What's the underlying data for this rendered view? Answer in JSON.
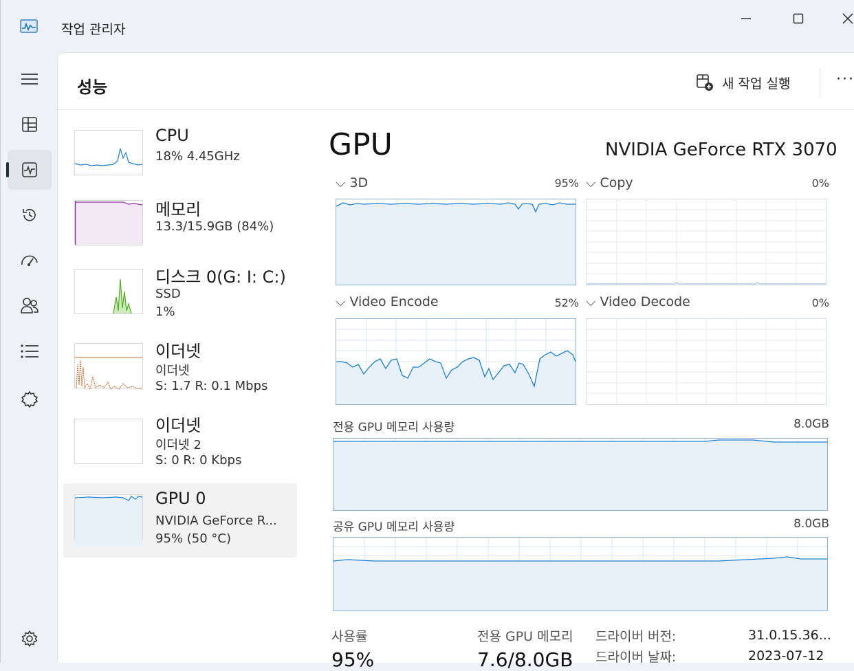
{
  "window": {
    "title": "작업 관리자"
  },
  "header": {
    "page_title": "성능",
    "run_task_label": "새 작업 실행",
    "more_label": "···"
  },
  "nav": {
    "items": [
      {
        "name": "menu",
        "icon": "hamburger-menu-icon"
      },
      {
        "name": "processes",
        "icon": "processes-icon"
      },
      {
        "name": "performance",
        "icon": "performance-icon",
        "active": true
      },
      {
        "name": "app-history",
        "icon": "history-icon"
      },
      {
        "name": "startup",
        "icon": "startup-speedometer-icon"
      },
      {
        "name": "users",
        "icon": "users-icon"
      },
      {
        "name": "details",
        "icon": "details-list-icon"
      },
      {
        "name": "services",
        "icon": "services-puzzle-icon"
      },
      {
        "name": "settings",
        "icon": "gear-icon"
      }
    ]
  },
  "sidebar": {
    "items": [
      {
        "title": "CPU",
        "line1": "18% 4.45GHz",
        "line2": "",
        "line3": "",
        "color": "#1a7fd1"
      },
      {
        "title": "메모리",
        "line1": "13.3/15.9GB (84%)",
        "line2": "",
        "line3": "",
        "color": "#8b2fa5"
      },
      {
        "title": "디스크 0(G: I: C:)",
        "line1": "SSD",
        "line2": "1%",
        "line3": "",
        "color": "#4caf18"
      },
      {
        "title": "이더넷",
        "line1": "이더넷",
        "line2": "S: 1.7  R: 0.1 Mbps",
        "line3": "",
        "color": "#c8652a"
      },
      {
        "title": "이더넷",
        "line1": "이더넷 2",
        "line2": "S: 0  R: 0 Kbps",
        "line3": "",
        "color": "#c8652a"
      },
      {
        "title": "GPU 0",
        "line1": "NVIDIA GeForce R...",
        "line2": "95% (50 °C)",
        "line3": "",
        "color": "#1a7fd1",
        "selected": true
      }
    ]
  },
  "gpu": {
    "title": "GPU",
    "name": "NVIDIA GeForce RTX 3070",
    "engines": [
      {
        "label": "3D",
        "percent": "95%"
      },
      {
        "label": "Copy",
        "percent": "0%"
      },
      {
        "label": "Video Encode",
        "percent": "52%"
      },
      {
        "label": "Video Decode",
        "percent": "0%"
      }
    ],
    "dedicated_mem": {
      "label": "전용 GPU 메모리 사용량",
      "max": "8.0GB"
    },
    "shared_mem": {
      "label": "공유 GPU 메모리 사용량",
      "max": "8.0GB"
    },
    "stats": {
      "usage_label": "사용률",
      "usage_value": "95%",
      "dedicated_label": "전용 GPU 메모리",
      "dedicated_value": "7.6/8.0GB"
    },
    "info": [
      {
        "label": "드라이버 버전:",
        "value": "31.0.15.36..."
      },
      {
        "label": "드라이버 날짜:",
        "value": "2023-07-12"
      }
    ]
  },
  "colors": {
    "gpu_line": "#1a7fd1",
    "gpu_fill": "#e8f1f9",
    "grid": "#d9e6f2"
  }
}
